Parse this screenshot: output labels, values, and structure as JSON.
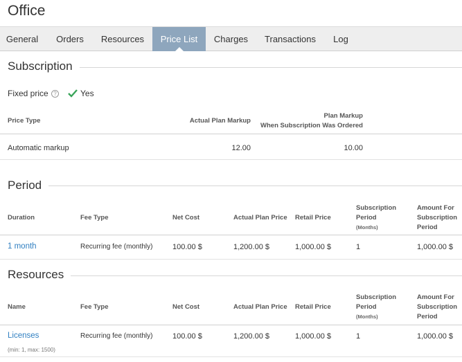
{
  "page": {
    "title": "Office"
  },
  "tabs": [
    {
      "label": "General"
    },
    {
      "label": "Orders"
    },
    {
      "label": "Resources"
    },
    {
      "label": "Price List",
      "active": true
    },
    {
      "label": "Charges"
    },
    {
      "label": "Transactions"
    },
    {
      "label": "Log"
    }
  ],
  "subscription": {
    "title": "Subscription",
    "fixed_price_label": "Fixed price",
    "help_icon": "question-circle-icon",
    "fixed_price_value": "Yes",
    "check_icon": "checkmark-icon",
    "check_color": "#3aa55a",
    "headers": {
      "price_type": "Price Type",
      "actual_plan_markup": "Actual Plan Markup",
      "plan_markup_line1": "Plan Markup",
      "plan_markup_line2": "When Subscription Was Ordered"
    },
    "rows": [
      {
        "price_type": "Automatic markup",
        "actual_plan_markup": "12.00",
        "plan_markup_ordered": "10.00"
      }
    ]
  },
  "period": {
    "title": "Period",
    "headers": {
      "duration": "Duration",
      "fee_type": "Fee Type",
      "net_cost": "Net Cost",
      "actual_plan_price": "Actual Plan Price",
      "retail_price": "Retail Price",
      "sub_period_line1": "Subscription",
      "sub_period_line2": "Period",
      "sub_period_unit": "(Months)",
      "amount_line1": "Amount For",
      "amount_line2": "Subscription",
      "amount_line3": "Period"
    },
    "rows": [
      {
        "duration": "1 month",
        "fee_type": "Recurring fee (monthly)",
        "net_cost": "100.00 $",
        "actual_plan_price": "1,200.00 $",
        "retail_price": "1,000.00 $",
        "subscription_period": "1",
        "amount": "1,000.00 $"
      }
    ]
  },
  "resources": {
    "title": "Resources",
    "headers": {
      "name": "Name",
      "fee_type": "Fee Type",
      "net_cost": "Net Cost",
      "actual_plan_price": "Actual Plan Price",
      "retail_price": "Retail Price",
      "sub_period_line1": "Subscription",
      "sub_period_line2": "Period",
      "sub_period_unit": "(Months)",
      "amount_line1": "Amount For",
      "amount_line2": "Subscription",
      "amount_line3": "Period"
    },
    "rows": [
      {
        "name": "Licenses",
        "note": "(min: 1, max: 1500)",
        "fee_type": "Recurring fee (monthly)",
        "net_cost": "100.00 $",
        "actual_plan_price": "1,200.00 $",
        "retail_price": "1,000.00 $",
        "subscription_period": "1",
        "amount": "1,000.00 $"
      }
    ]
  }
}
